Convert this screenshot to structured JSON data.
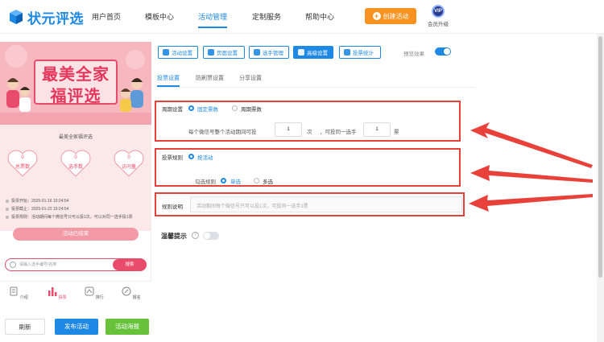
{
  "header": {
    "logo_text": "状元评选",
    "nav": [
      "用户首页",
      "模板中心",
      "活动管理",
      "定制服务",
      "帮助中心"
    ],
    "active_nav": "活动管理",
    "create_button": "创建活动",
    "vip_badge": "VIP",
    "vip_label": "会员升级"
  },
  "preview": {
    "banner_line1": "最美全家",
    "banner_line2": "福评选",
    "section_title": "最美全家福评选",
    "stats": [
      {
        "value": "0",
        "label": "总票数"
      },
      {
        "value": "0",
        "label": "选手数"
      },
      {
        "value": "0",
        "label": "访问量"
      }
    ],
    "info_lines": [
      "投票开始：2025-01-16 15:24:54",
      "投票截止：2025-01-22 15:24:54",
      "投票规则：活动期间每个微信号只可以投1次，可以对同一选手投1票"
    ],
    "status_button": "活动已结束",
    "search_placeholder": "请输入选手编号/名称",
    "search_button": "搜索",
    "tabs": [
      "介绍",
      "投票",
      "排行",
      "报名"
    ],
    "active_tab": "投票"
  },
  "footer": {
    "refresh": "刷新",
    "publish": "发布活动",
    "preview": "活动海报"
  },
  "settings": {
    "top_tabs": [
      "活动设置",
      "页面设置",
      "选手管理",
      "高级设置",
      "投票统计"
    ],
    "active_top_tab": "高级设置",
    "preview_effect_label": "预览效果",
    "preview_effect_on": true,
    "sub_tabs": [
      "投票设置",
      "防刷票设置",
      "分享设置"
    ],
    "active_sub_tab": "投票设置",
    "cycle": {
      "label": "周期设置",
      "options": [
        "固定票数",
        "周期票数"
      ],
      "selected": "固定票数",
      "desc_prefix": "每个微信号整个活动期间可投",
      "times_value": "1",
      "times_unit": "次",
      "desc_mid": "，可投同一选手",
      "votes_value": "1",
      "votes_unit": "票"
    },
    "rule": {
      "label": "投票规则",
      "option": "按活动",
      "check_label": "勾选规则",
      "check_options": [
        "单选",
        "多选"
      ],
      "check_selected": "单选"
    },
    "rules_desc": {
      "label": "规则说明",
      "placeholder": "活动期间每个微信号只可以投1次，可投同一选手1票"
    },
    "tip": {
      "label": "温馨提示",
      "help": "?",
      "enabled": false
    }
  },
  "colors": {
    "brand": "#1e88e5",
    "accent_orange": "#f7931e",
    "pink": "#e94b6a",
    "highlight_red": "#e8413a",
    "publish_blue": "#1e88e5",
    "poster_green": "#67c23a"
  }
}
